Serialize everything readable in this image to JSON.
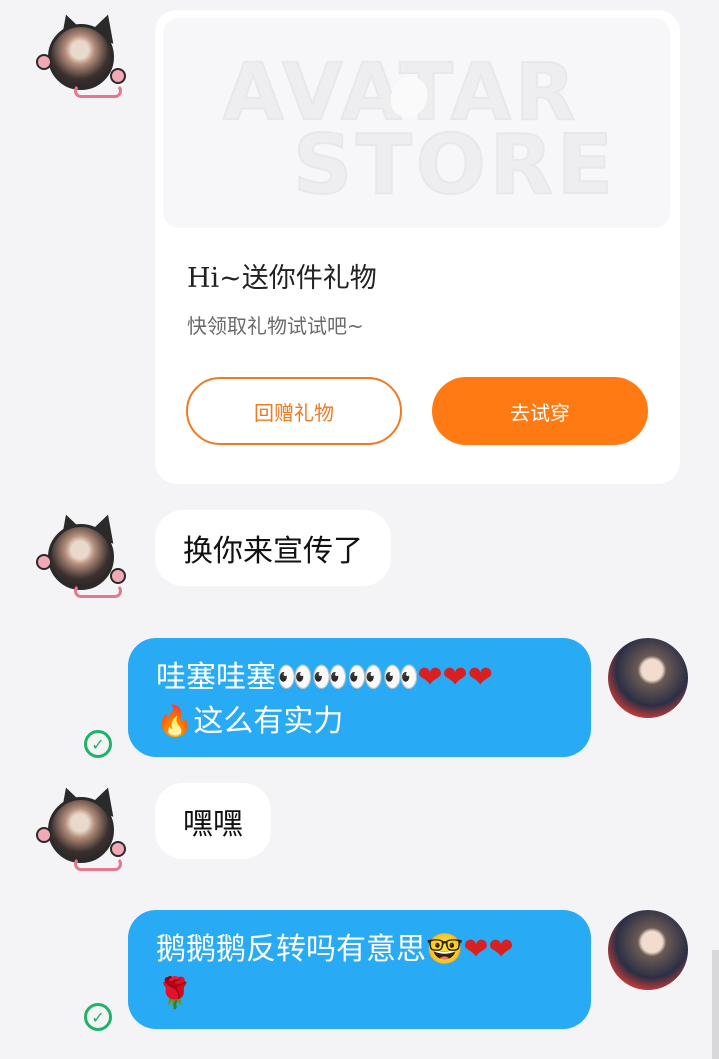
{
  "gift_card": {
    "banner_watermark_line1": "AVATAR",
    "banner_watermark_line2": "STORE",
    "title": "Hi~送你件礼物",
    "subtitle": "快领取礼物试试吧~",
    "return_gift_label": "回赠礼物",
    "try_on_label": "去试穿"
  },
  "messages": [
    {
      "side": "in",
      "text": "换你来宣传了"
    },
    {
      "side": "out",
      "line1_text": "哇塞哇塞",
      "line1_emoji": "👀👀👀👀",
      "line1_hearts": "❤❤❤",
      "line2_emoji": "🔥",
      "line2_text": "这么有实力",
      "status": "sent"
    },
    {
      "side": "in",
      "text": "嘿嘿"
    },
    {
      "side": "out",
      "line1_text": "鹅鹅鹅反转吗有意思",
      "line1_emoji": "🤓",
      "line1_hearts": "❤❤",
      "line2_emoji": "🌹",
      "status": "sent"
    }
  ],
  "icons": {
    "check": "✓"
  },
  "colors": {
    "accent_orange": "#ff7a13",
    "outgoing_bubble": "#29aaf4",
    "read_check": "#1fb26b"
  }
}
